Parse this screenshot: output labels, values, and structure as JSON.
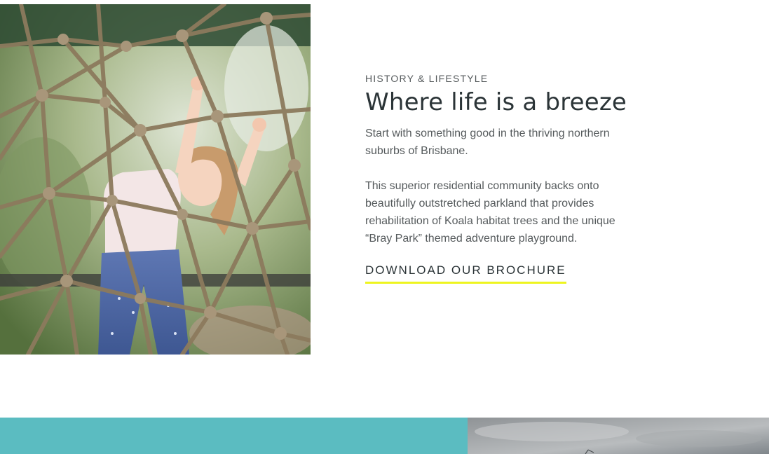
{
  "section": {
    "eyebrow": "HISTORY & LIFESTYLE",
    "headline": "Where life is a breeze",
    "paragraphs": [
      "Start with something good in the thriving northern suburbs of Brisbane.",
      "This superior residential community backs onto beautifully outstretched parkland that provides rehabilitation of Koala habitat trees and the unique “Bray Park” themed adventure playground."
    ],
    "cta_label": "DOWNLOAD OUR BROCHURE"
  },
  "colors": {
    "accent_underline": "#eef51f",
    "teal_band": "#5bbcc1",
    "heading_text": "#2b3437",
    "body_text": "#555a5c"
  }
}
